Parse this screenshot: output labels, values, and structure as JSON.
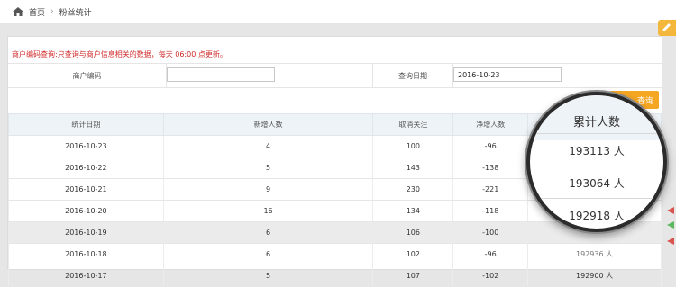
{
  "breadcrumb": {
    "home": "首页",
    "separator": "›",
    "current": "粉丝统计"
  },
  "notice": "商户编码查询:只查询与商户信息相关的数据，每天 06:00 点更新。",
  "search": {
    "merchant_label": "商户编码",
    "merchant_value": "",
    "date_label": "查询日期",
    "date_value": "2016-10-23",
    "query_button": "查询"
  },
  "table": {
    "headers": [
      "统计日期",
      "新增人数",
      "取消关注",
      "净增人数",
      "累计人数"
    ],
    "rows": [
      {
        "date": "2016-10-23",
        "new": "4",
        "cancel": "100",
        "net": "-96",
        "total": ""
      },
      {
        "date": "2016-10-22",
        "new": "5",
        "cancel": "143",
        "net": "-138",
        "total": ""
      },
      {
        "date": "2016-10-21",
        "new": "9",
        "cancel": "230",
        "net": "-221",
        "total": ""
      },
      {
        "date": "2016-10-20",
        "new": "16",
        "cancel": "134",
        "net": "-118",
        "total": ""
      },
      {
        "date": "2016-10-19",
        "new": "6",
        "cancel": "106",
        "net": "-100",
        "total": ""
      },
      {
        "date": "2016-10-18",
        "new": "6",
        "cancel": "102",
        "net": "-96",
        "total": "192936 人"
      },
      {
        "date": "2016-10-17",
        "new": "5",
        "cancel": "107",
        "net": "-102",
        "total": "192900 人"
      }
    ]
  },
  "magnifier": {
    "header": "累计人数",
    "values": [
      "193113 人",
      "193064 人",
      "192918 人"
    ]
  },
  "colors": {
    "accent": "#f5a623",
    "notice": "#d12b2b",
    "header_bg": "#eef3f8"
  }
}
